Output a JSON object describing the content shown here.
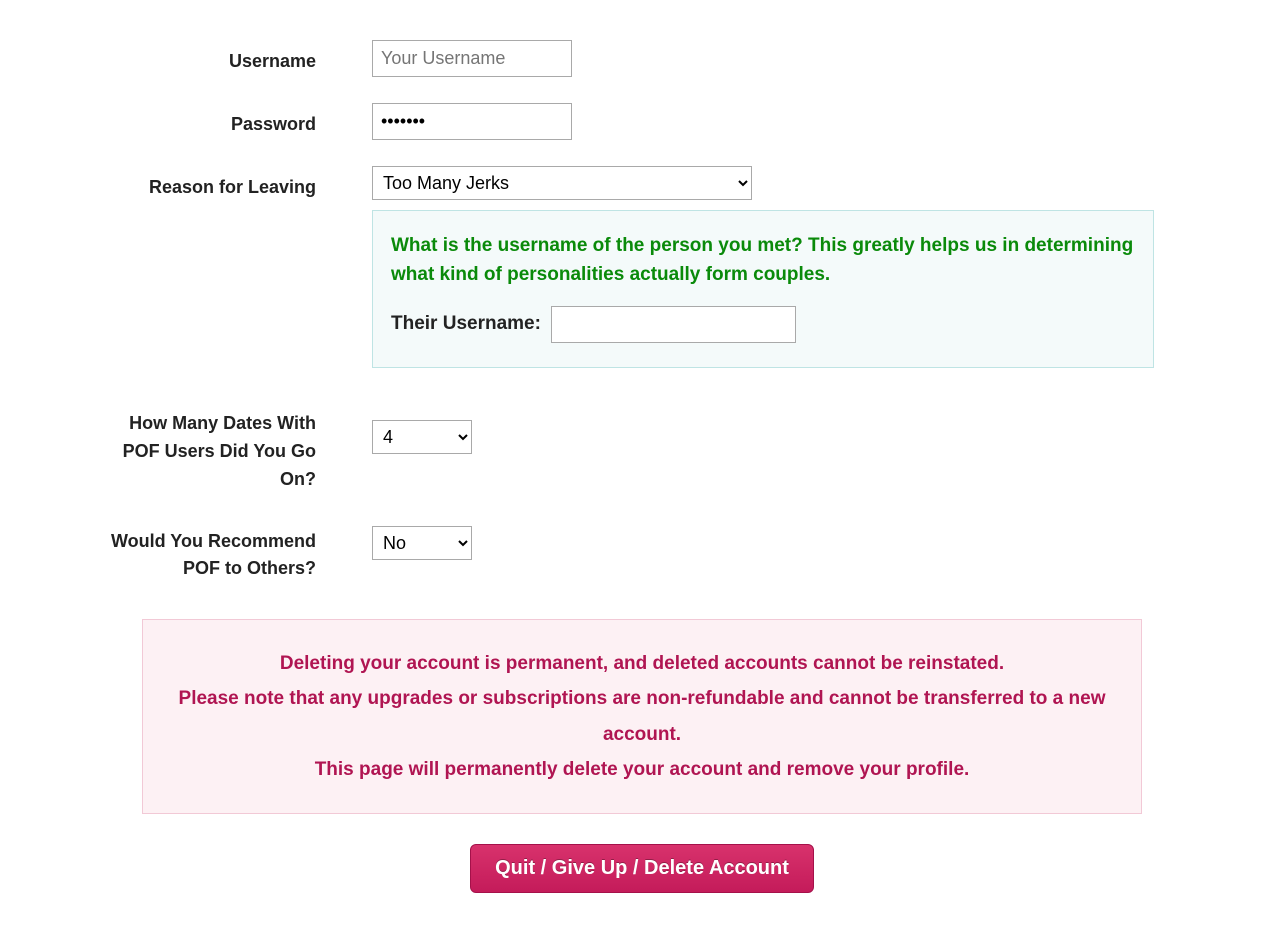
{
  "labels": {
    "username": "Username",
    "password": "Password",
    "reason": "Reason for Leaving",
    "dates": "How Many Dates With POF Users Did You Go On?",
    "recommend": "Would You Recommend POF to Others?",
    "their_username": "Their Username:"
  },
  "fields": {
    "username_placeholder": "Your Username",
    "username_value": "",
    "password_value": "•••••••",
    "reason_selected": "Too Many Jerks",
    "dates_selected": "4",
    "recommend_selected": "No",
    "their_username_value": ""
  },
  "callout": {
    "heading": "What is the username of the person you met? This greatly helps us in determining what kind of personalities actually form couples."
  },
  "warning": {
    "line1": "Deleting your account is permanent, and deleted accounts cannot be reinstated.",
    "line2": "Please note that any upgrades or subscriptions are non-refundable and cannot be transferred to a new account.",
    "line3": "This page will permanently delete your account and remove your profile."
  },
  "buttons": {
    "delete": "Quit / Give Up / Delete Account"
  }
}
